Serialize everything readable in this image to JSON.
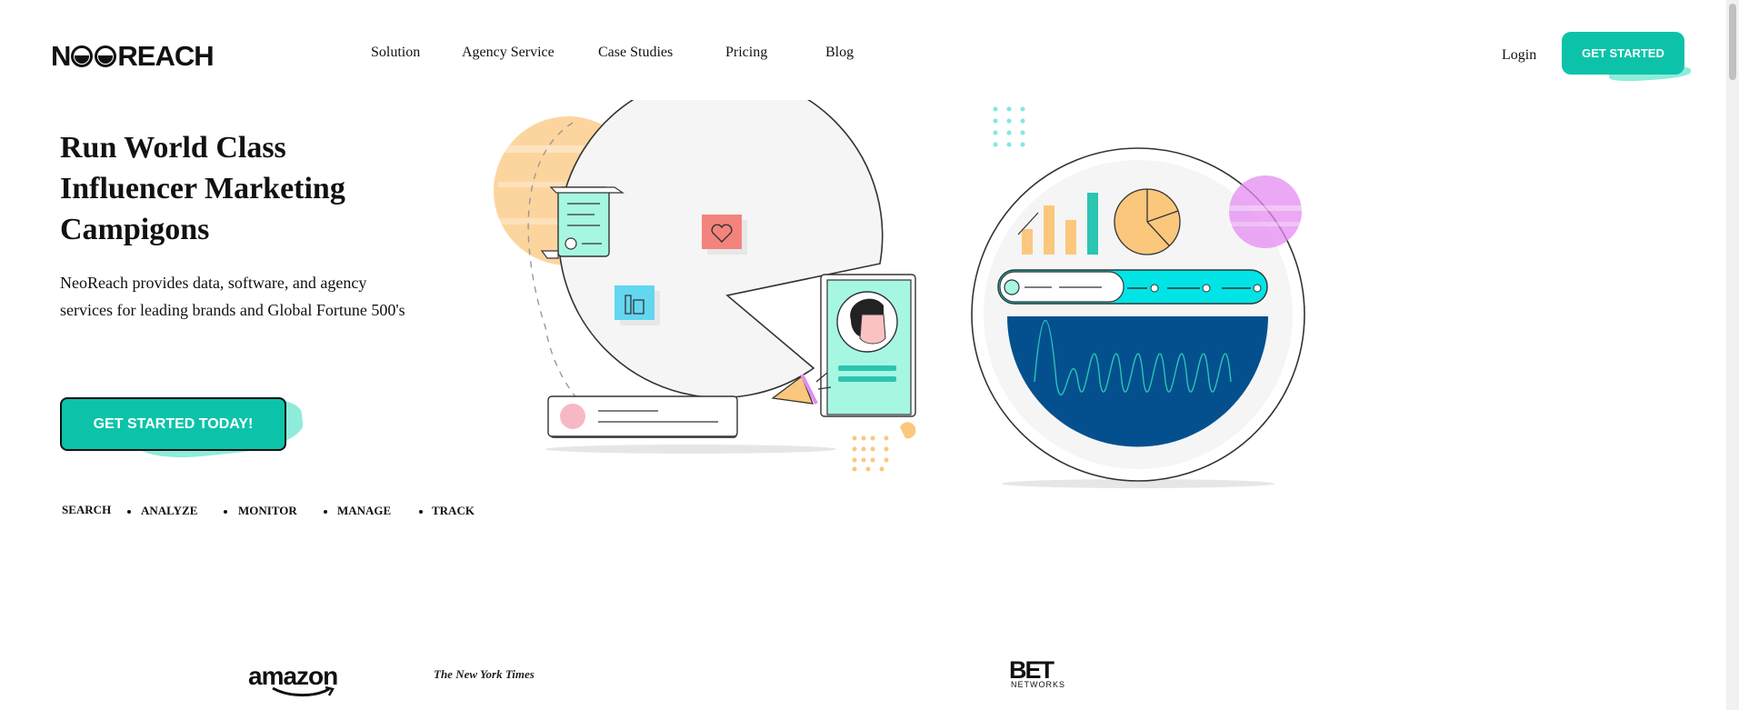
{
  "header": {
    "logo_text_before": "N",
    "logo_text_after": "REACH",
    "nav": [
      "Solution",
      "Agency Service",
      "Case Studies",
      "Pricing",
      "Blog"
    ],
    "login_label": "Login",
    "cta_label": "GET STARTED"
  },
  "hero": {
    "title": "Run World Class Influencer Marketing Campigons",
    "description": "NeoReach provides data, software, and agency services for leading brands and Global Fortune 500's",
    "cta_label": "GET STARTED TODAY!",
    "features": [
      "SEARCH",
      "ANALYZE",
      "MONITOR",
      "MANAGE",
      "TRACK"
    ]
  },
  "clients": {
    "amazon": "amazon",
    "nyt": "The New York Times",
    "bet": "BET",
    "bet_sub": "NETWORKS"
  },
  "colors": {
    "accent": "#0cc3a9",
    "accent_light": "#5ee4cc",
    "mint": "#a6f7e2",
    "orange": "#fbc77d",
    "navy": "#04508f",
    "pink": "#f7b8c6",
    "purple": "#e48cf2",
    "cyan": "#00e4e6"
  }
}
